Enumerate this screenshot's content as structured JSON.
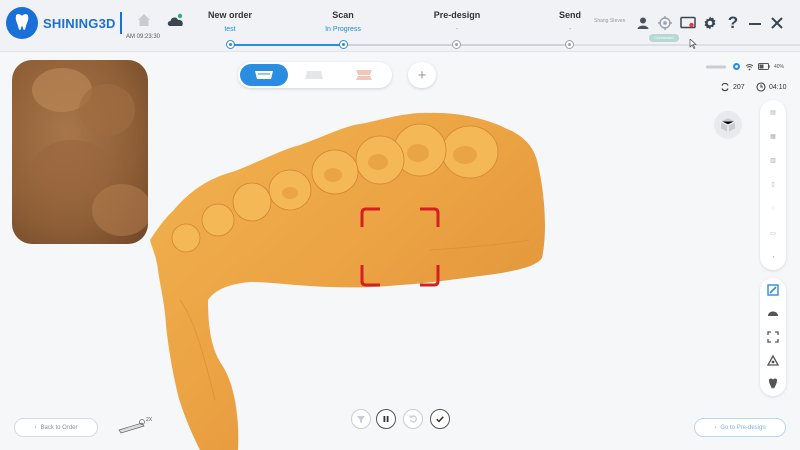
{
  "app": {
    "brand": "SHINING3D",
    "time": "AM 09:23:30",
    "user": "Shang Steven",
    "connect_label": "Connected"
  },
  "steps": [
    {
      "label": "New order",
      "sub": "test",
      "state": "done"
    },
    {
      "label": "Scan",
      "sub": "In Progress",
      "state": "current"
    },
    {
      "label": "Pre-design",
      "sub": "-",
      "state": "pending"
    },
    {
      "label": "Send",
      "sub": "-",
      "state": "pending"
    }
  ],
  "status": {
    "battery": "40%",
    "frames": "207",
    "duration": "04:10"
  },
  "probe": {
    "zoom": "2X"
  },
  "bottom": {
    "back_label": "Back to Order",
    "next_label": "Go to Pre-design"
  },
  "icons": {
    "home": "home-icon",
    "cloud": "cloud-icon",
    "user": "user-icon",
    "target": "crosshair-icon",
    "screen": "screen-record-icon",
    "settings": "gear-icon",
    "help": "help-icon",
    "minimize": "minimize-icon",
    "close": "close-icon"
  },
  "colors": {
    "accent": "#2a8de0",
    "brand": "#1a6fd8",
    "model": "#e8a445",
    "frame": "#d42020"
  }
}
